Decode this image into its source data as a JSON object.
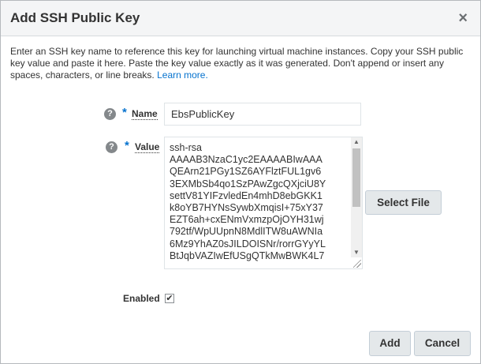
{
  "dialog": {
    "title": "Add SSH Public Key",
    "close_glyph": "×",
    "close_icon": "close-icon"
  },
  "intro": {
    "text": "Enter an SSH key name to reference this key for launching virtual machine instances. Copy your SSH public key value and paste it here. Paste the key value exactly as it was generated. Don't append or insert any spaces, characters, or line breaks.",
    "link": "Learn more."
  },
  "name_field": {
    "help_glyph": "?",
    "help_icon": "help-icon",
    "required_marker": "*",
    "label": "Name",
    "value": "EbsPublicKey"
  },
  "value_field": {
    "help_glyph": "?",
    "help_icon": "help-icon",
    "required_marker": "*",
    "label": "Value",
    "lines": [
      "ssh-rsa",
      "AAAAB3NzaC1yc2EAAAABIwAAA",
      "QEArn21PGy1SZ6AYFlztFUL1gv6",
      "3EXMbSb4qo1SzPAwZgcQXjciU8Y",
      "settV81YIFzvledEn4mhD8ebGKK1",
      "k8oYB7HYNsSywbXmqisI+75xY37",
      "EZT6ah+cxENmVxmzpOjOYH31wj",
      "792tf/WpUUpnN8MdlITW8uAWNIa",
      "6Mz9YhAZ0sJILDOISNr/rorrGYyYL",
      "BtJqbVAZIwEfUSgQTkMwBWK4L7"
    ]
  },
  "select_file_label": "Select File",
  "enabled": {
    "label": "Enabled",
    "checked": true,
    "check_glyph": "✔"
  },
  "footer": {
    "add_label": "Add",
    "cancel_label": "Cancel"
  },
  "colors": {
    "accent": "#0572ce",
    "header_bg": "#f4f5f6",
    "button_bg": "#e4e8ea"
  }
}
